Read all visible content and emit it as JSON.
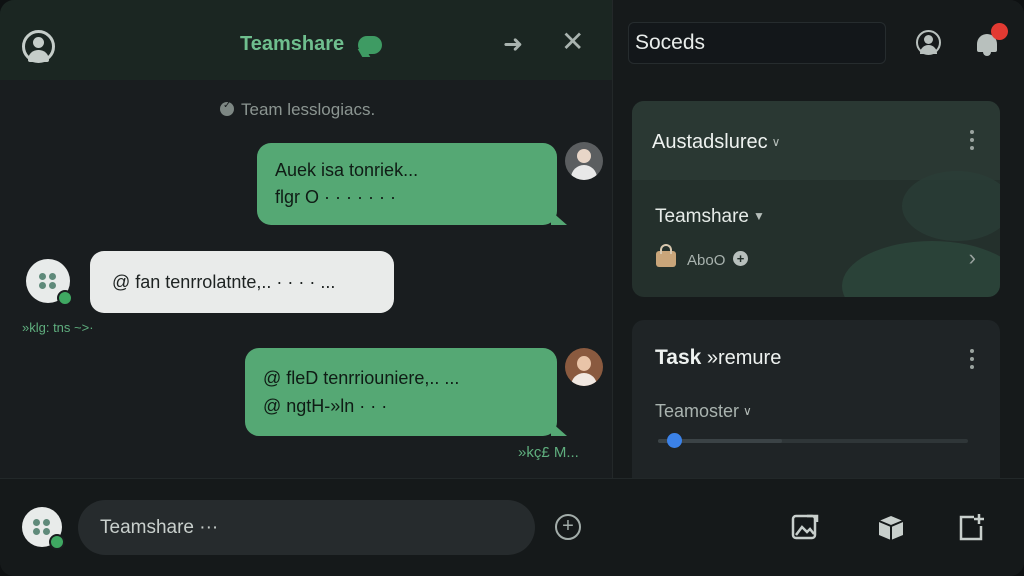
{
  "window": {
    "traffic_lights": [
      "close",
      "minimize",
      "zoom"
    ]
  },
  "chat": {
    "header_title": "Teamshare",
    "system_note": "Team lesslogiacs.",
    "messages": [
      {
        "side": "right",
        "style": "green",
        "lines": [
          "Auek isa tonriek...",
          "flgr O · · · · · · ·"
        ]
      },
      {
        "side": "left",
        "style": "white",
        "lines": [
          "@ fan tenrrolatnte,.. · · · · ..."
        ]
      },
      {
        "side": "right",
        "style": "green",
        "lines": [
          "@ fleD tenrriouniere,..     ...",
          "@ ngtH-»ln · · ·"
        ]
      }
    ],
    "sender_meta": "»klg: tns ~>·",
    "time_meta": "»kç£ M..."
  },
  "composer": {
    "input_value": "Teamshare ···",
    "add_symbol": "+"
  },
  "right_panel": {
    "search_value": "Soceds",
    "card1": {
      "title": "Austadslurec",
      "subtitle": "Teamshare",
      "meta": "AboO"
    },
    "card2": {
      "title_strong": "Task",
      "title_rest": " »remure",
      "subtitle": "Teamoster",
      "progress": 0.05
    }
  },
  "colors": {
    "accent_green": "#55a874",
    "notification_red": "#e23a32",
    "slider_blue": "#3b82e8"
  },
  "icons": [
    "user-icon",
    "chat-bubble-icon",
    "forward-arrow-icon",
    "close-icon",
    "bell-icon",
    "lock-icon",
    "plus-icon",
    "chevron-right-icon",
    "image-edit-icon",
    "box-icon",
    "add-page-icon"
  ]
}
